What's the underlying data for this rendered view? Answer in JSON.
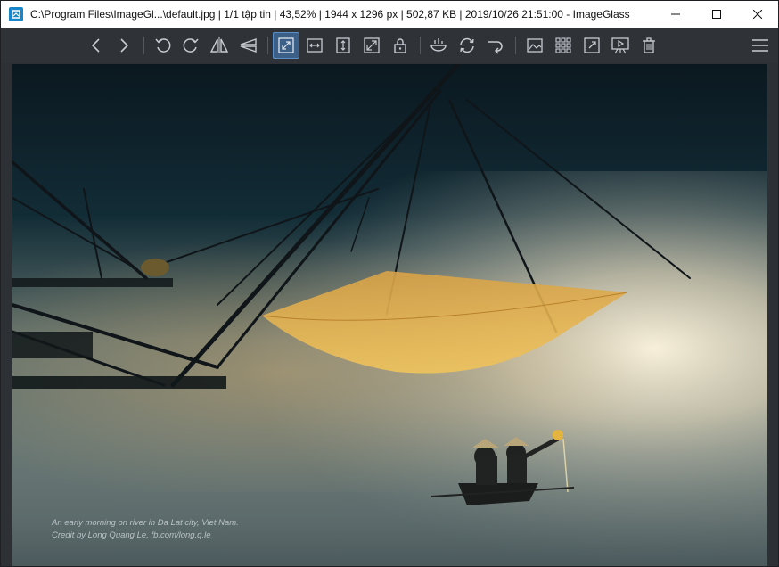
{
  "window": {
    "title": "C:\\Program Files\\ImageGl...\\default.jpg  |  1/1 tập tin  |  43,52%  |  1944 x 1296 px  |  502,87 KB  |  2019/10/26 21:51:00  - ImageGlass",
    "minimize_symbol": "—",
    "maximize_symbol": "☐",
    "close_symbol": "✕"
  },
  "toolbar": {
    "buttons": [
      {
        "name": "previous-image-icon"
      },
      {
        "name": "next-image-icon"
      },
      {
        "name": "rotate-left-icon"
      },
      {
        "name": "rotate-right-icon"
      },
      {
        "name": "flip-horizontal-icon"
      },
      {
        "name": "flip-vertical-icon"
      },
      {
        "name": "auto-zoom-icon",
        "active": true
      },
      {
        "name": "scale-to-width-icon"
      },
      {
        "name": "scale-to-height-icon"
      },
      {
        "name": "scale-to-fit-icon"
      },
      {
        "name": "lock-zoom-icon"
      },
      {
        "name": "checkerboard-background-icon"
      },
      {
        "name": "refresh-icon"
      },
      {
        "name": "goto-image-icon"
      },
      {
        "name": "thumbnail-bar-icon"
      },
      {
        "name": "gallery-grid-icon"
      },
      {
        "name": "fullscreen-icon"
      },
      {
        "name": "slideshow-icon"
      },
      {
        "name": "delete-icon"
      },
      {
        "name": "main-menu-icon"
      }
    ]
  },
  "image": {
    "caption_line1": "An early morning on river in Da Lat city, Viet Nam.",
    "caption_line2": "Credit by Long Quang Le, fb.com/long.q.le"
  },
  "colors": {
    "toolbar_bg": "#2f3237",
    "icon": "#c8ccd2",
    "active_bg": "#3b5f86",
    "accent": "#1787c9"
  }
}
